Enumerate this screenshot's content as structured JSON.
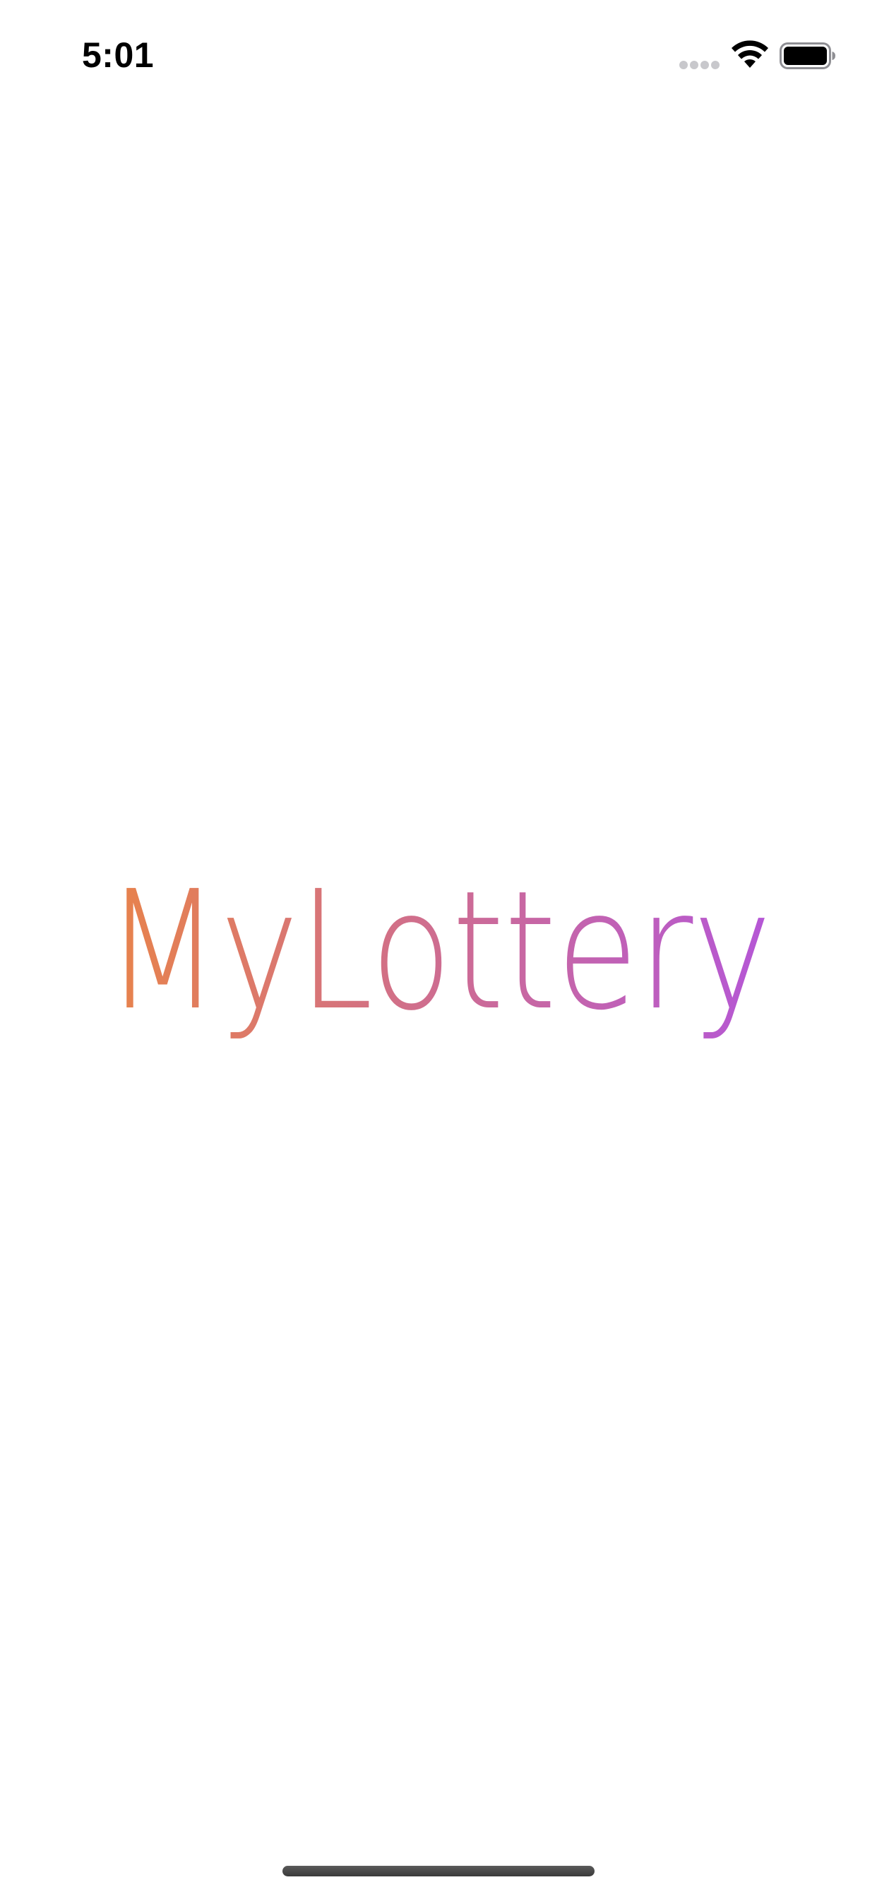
{
  "status_bar": {
    "time": "5:01",
    "signal_icon": "cellular-signal-icon",
    "wifi_icon": "wifi-icon",
    "battery_icon": "battery-icon"
  },
  "splash": {
    "app_name": "MyLottery",
    "gradient_start_color": "#E8834A",
    "gradient_end_color": "#B456D8"
  },
  "home_indicator": {
    "color": "#4a4a4a"
  }
}
